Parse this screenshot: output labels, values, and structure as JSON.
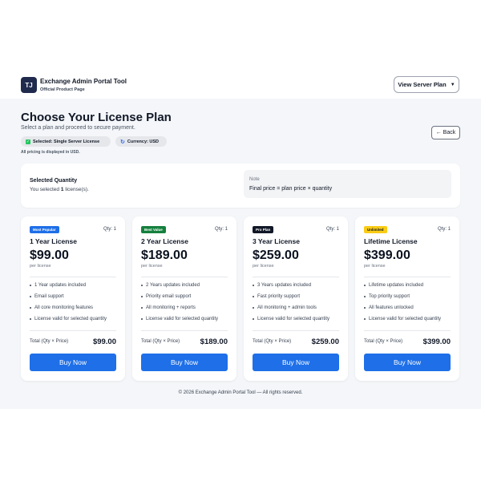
{
  "header": {
    "logo_text": "TJ",
    "app_name": "Exchange Admin Portal Tool",
    "app_subtitle": "Official Product Page",
    "server_plan_button": "View Server Plan"
  },
  "page": {
    "title": "Choose Your License Plan",
    "subtitle": "Select a plan and proceed to secure payment.",
    "chips": {
      "selected": "Selected: Single Server License",
      "currency": "Currency: USD"
    },
    "pricing_note": "All pricing is displayed in USD.",
    "back_button": "← Back"
  },
  "quantity": {
    "label": "Selected Quantity",
    "text_prefix": "You selected",
    "value": "1",
    "text_suffix": "license(s).",
    "note_title": "Note",
    "note_formula": "Final price = plan price × quantity"
  },
  "plans": [
    {
      "badge": "Most Popular",
      "badge_bg": "#1e6fe8",
      "badge_fg": "#ffffff",
      "qty": "Qty: 1",
      "name": "1 Year License",
      "price": "$99.00",
      "per": "per license",
      "features": [
        "1 Year updates included",
        "Email support",
        "All core monitoring features",
        "License valid for selected quantity"
      ],
      "total_label": "Total (Qty × Price)",
      "total": "$99.00",
      "buy": "Buy Now"
    },
    {
      "badge": "Best Value",
      "badge_bg": "#15803d",
      "badge_fg": "#ffffff",
      "qty": "Qty: 1",
      "name": "2 Year License",
      "price": "$189.00",
      "per": "per license",
      "features": [
        "2 Years updates included",
        "Priority email support",
        "All monitoring + reports",
        "License valid for selected quantity"
      ],
      "total_label": "Total (Qty × Price)",
      "total": "$189.00",
      "buy": "Buy Now"
    },
    {
      "badge": "Pro Plan",
      "badge_bg": "#111827",
      "badge_fg": "#ffffff",
      "qty": "Qty: 1",
      "name": "3 Year License",
      "price": "$259.00",
      "per": "per license",
      "features": [
        "3 Years updates included",
        "Fast priority support",
        "All monitoring + admin tools",
        "License valid for selected quantity"
      ],
      "total_label": "Total (Qty × Price)",
      "total": "$259.00",
      "buy": "Buy Now"
    },
    {
      "badge": "Unlimited",
      "badge_bg": "#facc15",
      "badge_fg": "#111827",
      "qty": "Qty: 1",
      "name": "Lifetime License",
      "price": "$399.00",
      "per": "per license",
      "features": [
        "Lifetime updates included",
        "Top priority support",
        "All features unlocked",
        "License valid for selected quantity"
      ],
      "total_label": "Total (Qty × Price)",
      "total": "$399.00",
      "buy": "Buy Now"
    }
  ],
  "footer": {
    "text": "© 2026 Exchange Admin Portal Tool — All rights reserved."
  }
}
